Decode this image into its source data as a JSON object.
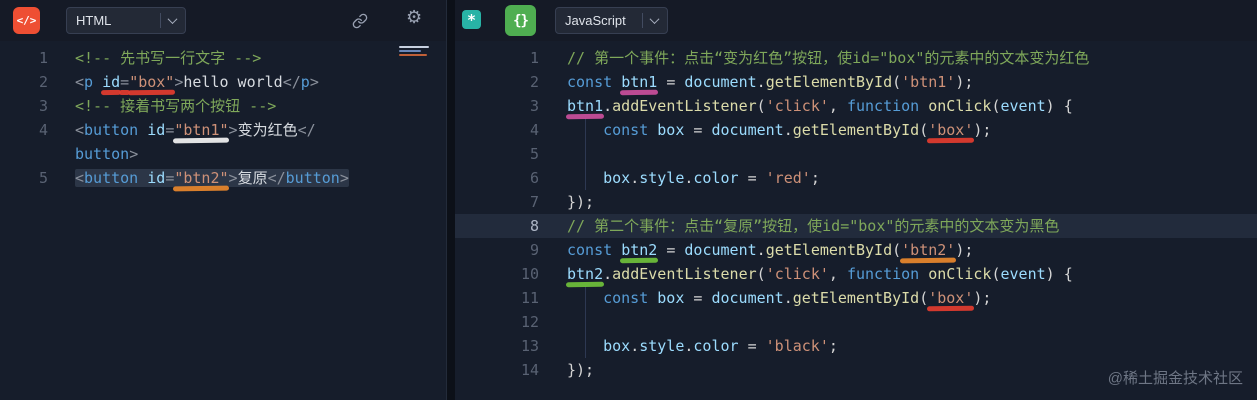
{
  "left_panel": {
    "language_label": "HTML",
    "icon_glyph": "</>",
    "lines": [
      {
        "num": "1",
        "tokens": [
          {
            "t": "<!-- 先书写一行文字 -->",
            "c": "cm"
          }
        ]
      },
      {
        "num": "2",
        "tokens": [
          {
            "t": "<",
            "c": "br"
          },
          {
            "t": "p",
            "c": "tg"
          },
          {
            "t": " ",
            "c": "tx"
          },
          {
            "t": "id",
            "c": "at",
            "m": "red"
          },
          {
            "t": "=",
            "c": "br",
            "m": "red"
          },
          {
            "t": "\"box\"",
            "c": "st",
            "m": "red"
          },
          {
            "t": ">",
            "c": "br"
          },
          {
            "t": "hello world",
            "c": "tx"
          },
          {
            "t": "</",
            "c": "br"
          },
          {
            "t": "p",
            "c": "tg"
          },
          {
            "t": ">",
            "c": "br"
          }
        ]
      },
      {
        "num": "3",
        "tokens": [
          {
            "t": "<!-- 接着书写两个按钮 -->",
            "c": "cm"
          }
        ]
      },
      {
        "num": "4",
        "tokens": [
          {
            "t": "<",
            "c": "br"
          },
          {
            "t": "button",
            "c": "tg"
          },
          {
            "t": " ",
            "c": "tx"
          },
          {
            "t": "id",
            "c": "at"
          },
          {
            "t": "=",
            "c": "br"
          },
          {
            "t": "\"btn1\"",
            "c": "st",
            "m": "white"
          },
          {
            "t": ">",
            "c": "br"
          },
          {
            "t": "变为红色",
            "c": "tx"
          },
          {
            "t": "</",
            "c": "br"
          }
        ]
      },
      {
        "num": "",
        "tokens": [
          {
            "t": "button",
            "c": "tg"
          },
          {
            "t": ">",
            "c": "br"
          }
        ]
      },
      {
        "num": "5",
        "sel": true,
        "tokens": [
          {
            "t": "<",
            "c": "br"
          },
          {
            "t": "button",
            "c": "tg"
          },
          {
            "t": " ",
            "c": "tx"
          },
          {
            "t": "id",
            "c": "at"
          },
          {
            "t": "=",
            "c": "br"
          },
          {
            "t": "\"btn2\"",
            "c": "st",
            "m": "orange"
          },
          {
            "t": ">",
            "c": "br"
          },
          {
            "t": "复原",
            "c": "tx"
          },
          {
            "t": "</",
            "c": "br"
          },
          {
            "t": "button",
            "c": "tg"
          },
          {
            "t": ">",
            "c": "br"
          }
        ]
      }
    ]
  },
  "right_panel": {
    "language_label": "JavaScript",
    "icon_glyph": "{}",
    "badge_glyph": "*",
    "lines": [
      {
        "num": "1",
        "tokens": [
          {
            "t": "// 第一个事件：点击“变为红色”按钮，使id=\"box\"的元素中的文本变为红色",
            "c": "cm"
          }
        ]
      },
      {
        "num": "2",
        "tokens": [
          {
            "t": "const",
            "c": "kw"
          },
          {
            "t": " ",
            "c": "tx"
          },
          {
            "t": "btn1",
            "c": "vr",
            "m": "pink"
          },
          {
            "t": " = ",
            "c": "pu"
          },
          {
            "t": "document",
            "c": "vr"
          },
          {
            "t": ".",
            "c": "pu"
          },
          {
            "t": "getElementById",
            "c": "fn"
          },
          {
            "t": "(",
            "c": "pu"
          },
          {
            "t": "'btn1'",
            "c": "st"
          },
          {
            "t": ");",
            "c": "pu"
          }
        ]
      },
      {
        "num": "3",
        "tokens": [
          {
            "t": "btn1",
            "c": "vr",
            "m": "pink"
          },
          {
            "t": ".",
            "c": "pu"
          },
          {
            "t": "addEventListener",
            "c": "fn"
          },
          {
            "t": "(",
            "c": "pu"
          },
          {
            "t": "'click'",
            "c": "st"
          },
          {
            "t": ", ",
            "c": "pu"
          },
          {
            "t": "function",
            "c": "kw"
          },
          {
            "t": " ",
            "c": "tx"
          },
          {
            "t": "onClick",
            "c": "fn"
          },
          {
            "t": "(",
            "c": "pu"
          },
          {
            "t": "event",
            "c": "vr"
          },
          {
            "t": ") {",
            "c": "pu"
          }
        ]
      },
      {
        "num": "4",
        "tokens": [
          {
            "t": "",
            "c": "ind"
          },
          {
            "t": "const",
            "c": "kw"
          },
          {
            "t": " ",
            "c": "tx"
          },
          {
            "t": "box",
            "c": "vr"
          },
          {
            "t": " = ",
            "c": "pu"
          },
          {
            "t": "document",
            "c": "vr"
          },
          {
            "t": ".",
            "c": "pu"
          },
          {
            "t": "getElementById",
            "c": "fn"
          },
          {
            "t": "(",
            "c": "pu"
          },
          {
            "t": "'box'",
            "c": "st",
            "m": "red"
          },
          {
            "t": ");",
            "c": "pu"
          }
        ]
      },
      {
        "num": "5",
        "tokens": [
          {
            "t": "",
            "c": "ind"
          }
        ]
      },
      {
        "num": "6",
        "tokens": [
          {
            "t": "",
            "c": "ind"
          },
          {
            "t": "box",
            "c": "vr"
          },
          {
            "t": ".",
            "c": "pu"
          },
          {
            "t": "style",
            "c": "vr"
          },
          {
            "t": ".",
            "c": "pu"
          },
          {
            "t": "color",
            "c": "vr"
          },
          {
            "t": " = ",
            "c": "pu"
          },
          {
            "t": "'red'",
            "c": "st"
          },
          {
            "t": ";",
            "c": "pu"
          }
        ]
      },
      {
        "num": "7",
        "tokens": [
          {
            "t": "});",
            "c": "pu"
          }
        ]
      },
      {
        "num": "8",
        "hl": true,
        "tokens": [
          {
            "t": "// 第二个事件：点击“复原”按钮，使id=\"box\"的元素中的文本变为黑色",
            "c": "cm"
          }
        ]
      },
      {
        "num": "9",
        "tokens": [
          {
            "t": "const",
            "c": "kw"
          },
          {
            "t": " ",
            "c": "tx"
          },
          {
            "t": "btn2",
            "c": "vr",
            "m": "green"
          },
          {
            "t": " = ",
            "c": "pu"
          },
          {
            "t": "document",
            "c": "vr"
          },
          {
            "t": ".",
            "c": "pu"
          },
          {
            "t": "getElementById",
            "c": "fn"
          },
          {
            "t": "(",
            "c": "pu"
          },
          {
            "t": "'btn2'",
            "c": "st",
            "m": "orange"
          },
          {
            "t": ");",
            "c": "pu"
          }
        ]
      },
      {
        "num": "10",
        "tokens": [
          {
            "t": "btn2",
            "c": "vr",
            "m": "green"
          },
          {
            "t": ".",
            "c": "pu"
          },
          {
            "t": "addEventListener",
            "c": "fn"
          },
          {
            "t": "(",
            "c": "pu"
          },
          {
            "t": "'click'",
            "c": "st"
          },
          {
            "t": ", ",
            "c": "pu"
          },
          {
            "t": "function",
            "c": "kw"
          },
          {
            "t": " ",
            "c": "tx"
          },
          {
            "t": "onClick",
            "c": "fn"
          },
          {
            "t": "(",
            "c": "pu"
          },
          {
            "t": "event",
            "c": "vr"
          },
          {
            "t": ") {",
            "c": "pu"
          }
        ]
      },
      {
        "num": "11",
        "tokens": [
          {
            "t": "",
            "c": "ind"
          },
          {
            "t": "const",
            "c": "kw"
          },
          {
            "t": " ",
            "c": "tx"
          },
          {
            "t": "box",
            "c": "vr"
          },
          {
            "t": " = ",
            "c": "pu"
          },
          {
            "t": "document",
            "c": "vr"
          },
          {
            "t": ".",
            "c": "pu"
          },
          {
            "t": "getElementById",
            "c": "fn"
          },
          {
            "t": "(",
            "c": "pu"
          },
          {
            "t": "'box'",
            "c": "st",
            "m": "red"
          },
          {
            "t": ");",
            "c": "pu"
          }
        ]
      },
      {
        "num": "12",
        "tokens": [
          {
            "t": "",
            "c": "ind"
          }
        ]
      },
      {
        "num": "13",
        "tokens": [
          {
            "t": "",
            "c": "ind"
          },
          {
            "t": "box",
            "c": "vr"
          },
          {
            "t": ".",
            "c": "pu"
          },
          {
            "t": "style",
            "c": "vr"
          },
          {
            "t": ".",
            "c": "pu"
          },
          {
            "t": "color",
            "c": "vr"
          },
          {
            "t": " = ",
            "c": "pu"
          },
          {
            "t": "'black'",
            "c": "st"
          },
          {
            "t": ";",
            "c": "pu"
          }
        ]
      },
      {
        "num": "14",
        "tokens": [
          {
            "t": "});",
            "c": "pu"
          }
        ]
      }
    ]
  },
  "annotation_colors": {
    "red": "#e23b2e",
    "white": "#f2f2f2",
    "orange": "#e8862c",
    "pink": "#c94f9b",
    "green": "#6fbf3a"
  },
  "colors": {
    "html_icon_bg": "#ee4f33",
    "js_icon_bg": "#4fae51",
    "badge_bg": "#28b3a6",
    "comment": "#7fa85a",
    "keyword": "#569cd6",
    "string": "#ce9178",
    "variable": "#9cdcfe",
    "function": "#dcdcaa"
  },
  "watermark": "@稀土掘金技术社区"
}
